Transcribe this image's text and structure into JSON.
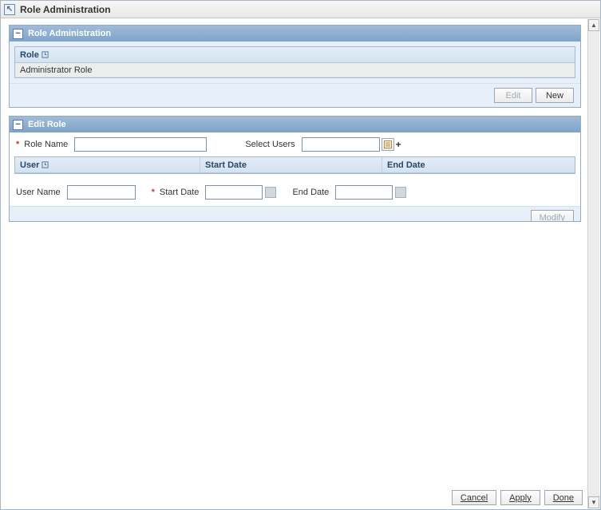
{
  "window": {
    "title": "Role Administration"
  },
  "roles_panel": {
    "title": "Role Administration",
    "column": "Role",
    "rows": [
      {
        "role": "Administrator Role"
      }
    ],
    "buttons": {
      "edit": "Edit",
      "new": "New"
    },
    "edit_disabled": true
  },
  "edit_panel": {
    "title": "Edit Role",
    "fields": {
      "role_name_label": "Role Name",
      "role_name_value": "",
      "select_users_label": "Select Users",
      "select_users_value": ""
    },
    "grid_columns": {
      "user": "User",
      "start_date": "Start Date",
      "end_date": "End Date"
    },
    "bottom_fields": {
      "user_name_label": "User Name",
      "user_name_value": "",
      "start_date_label": "Start Date",
      "start_date_value": "",
      "end_date_label": "End Date",
      "end_date_value": ""
    },
    "modify_button": "Modify",
    "modify_disabled": true
  },
  "actions": {
    "cancel": "Cancel",
    "apply": "Apply",
    "done": "Done"
  }
}
